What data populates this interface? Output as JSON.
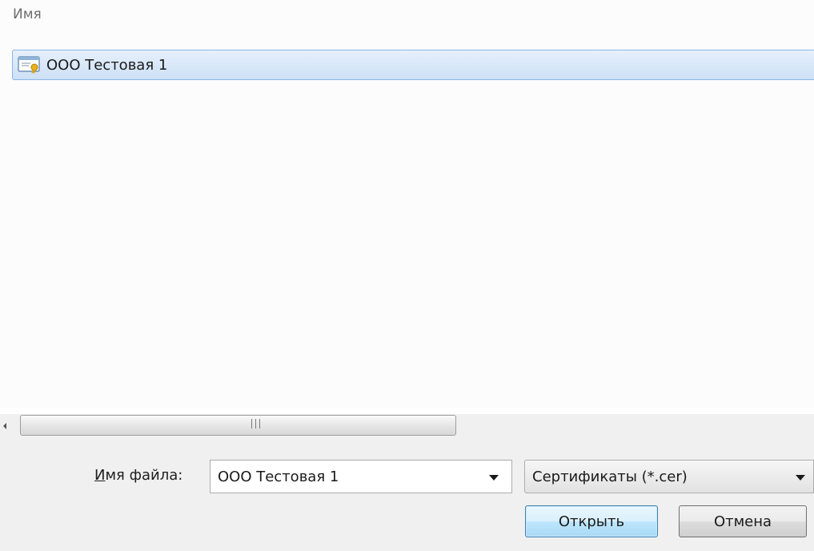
{
  "file_list": {
    "column_header": "Имя",
    "items": [
      {
        "name": "ООО Тестовая 1",
        "icon": "certificate-icon",
        "selected": true
      }
    ]
  },
  "bottom": {
    "filename_label": "Имя файла:",
    "filename_value": "ООО Тестовая 1",
    "filter_value": "Сертификаты (*.cer)",
    "open_label": "Открыть",
    "cancel_label": "Отмена"
  },
  "colors": {
    "selection": "#cde0f6",
    "selection_border": "#8ab5e6",
    "panel_background": "#f0f0f0",
    "default_button_border": "#3c7fb1"
  }
}
